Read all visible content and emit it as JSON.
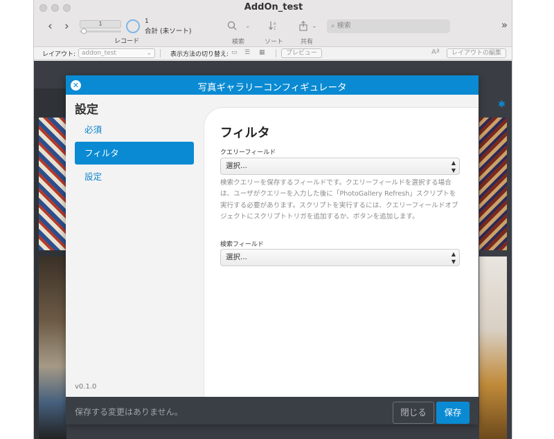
{
  "window": {
    "title": "AddOn_test"
  },
  "toolbar": {
    "record_value": "1",
    "record_label": "レコード",
    "record_count": "1",
    "record_total": "合計 (未ソート)",
    "search_label": "検索",
    "sort_label": "ソート",
    "share_label": "共有",
    "search_placeholder": "検索",
    "overflow": "»"
  },
  "layout_bar": {
    "layout_label": "レイアウト:",
    "layout_value": "addon_test",
    "view_switch_label": "表示方法の切り替え:",
    "preview_button": "プレビュー",
    "edit_layout_button": "レイアウトの編集"
  },
  "modal": {
    "title": "写真ギャラリーコンフィギュレータ",
    "sidebar": {
      "title": "設定",
      "items": [
        {
          "label": "必須",
          "active": false
        },
        {
          "label": "フィルタ",
          "active": true
        },
        {
          "label": "設定",
          "active": false
        }
      ],
      "version": "v0.1.0"
    },
    "panel": {
      "title": "フィルタ",
      "query_field_label": "クエリーフィールド",
      "query_field_value": "選択...",
      "help_text": "検索クエリーを保存するフィールドです。クエリーフィールドを選択する場合は、ユーザがクエリーを入力した後に「PhotoGallery Refresh」スクリプトを実行する必要があります。スクリプトを実行するには、クエリーフィールドオブジェクトにスクリプトトリガを追加するか、ボタンを追加します。",
      "search_field_label": "検索フィールド",
      "search_field_value": "選択..."
    },
    "footer": {
      "message": "保存する変更はありません。",
      "close_button": "閉じる",
      "save_button": "保存"
    }
  },
  "colors": {
    "accent": "#0a8ad3",
    "footer_bg": "#3a3f45"
  }
}
